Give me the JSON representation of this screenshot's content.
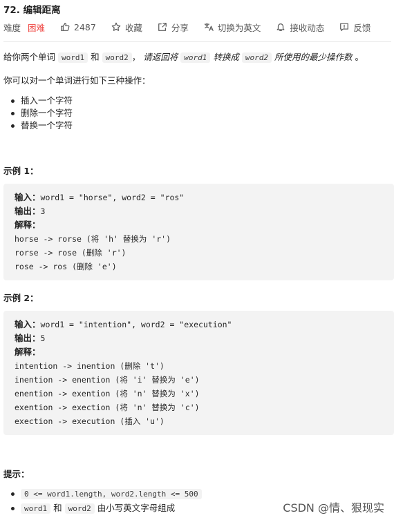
{
  "problem": {
    "title": "72. 编辑距离",
    "difficulty_label": "难度",
    "difficulty": "困难",
    "likes": "2487",
    "favorite": "收藏",
    "share": "分享",
    "switch_lang": "切换为英文",
    "subscribe": "接收动态",
    "feedback": "反馈"
  },
  "description": {
    "intro_prefix": "给你两个单词",
    "word1": "word1",
    "and": "和",
    "word2": "word2",
    "comma": "，",
    "ask_prefix": "请返回将",
    "ask_word1": "word1",
    "ask_mid": "转换成",
    "ask_word2": "word2",
    "ask_suffix": "所使用的最少操作数",
    "period": "。",
    "ops_intro": "你可以对一个单词进行如下三种操作：",
    "ops": [
      "插入一个字符",
      "删除一个字符",
      "替换一个字符"
    ]
  },
  "example1": {
    "title": "示例 1：",
    "input_label": "输入：",
    "input": "word1 = \"horse\", word2 = \"ros\"",
    "output_label": "输出：",
    "output": "3",
    "explain_label": "解释：",
    "steps": [
      "horse -> rorse (将 'h' 替换为 'r')",
      "rorse -> rose (删除 'r')",
      "rose -> ros (删除 'e')"
    ]
  },
  "example2": {
    "title": "示例 2：",
    "input_label": "输入：",
    "input": "word1 = \"intention\", word2 = \"execution\"",
    "output_label": "输出：",
    "output": "5",
    "explain_label": "解释：",
    "steps": [
      "intention -> inention (删除 't')",
      "inention -> enention (将 'i' 替换为 'e')",
      "enention -> exention (将 'n' 替换为 'x')",
      "exention -> exection (将 'n' 替换为 'c')",
      "exection -> execution (插入 'u')"
    ]
  },
  "hints": {
    "title": "提示：",
    "constraint1": "0 <= word1.length, word2.length <= 500",
    "c2_word1": "word1",
    "c2_and": "和",
    "c2_word2": "word2",
    "c2_suffix": "由小写英文字母组成"
  },
  "watermark": "CSDN @情、狠现实"
}
